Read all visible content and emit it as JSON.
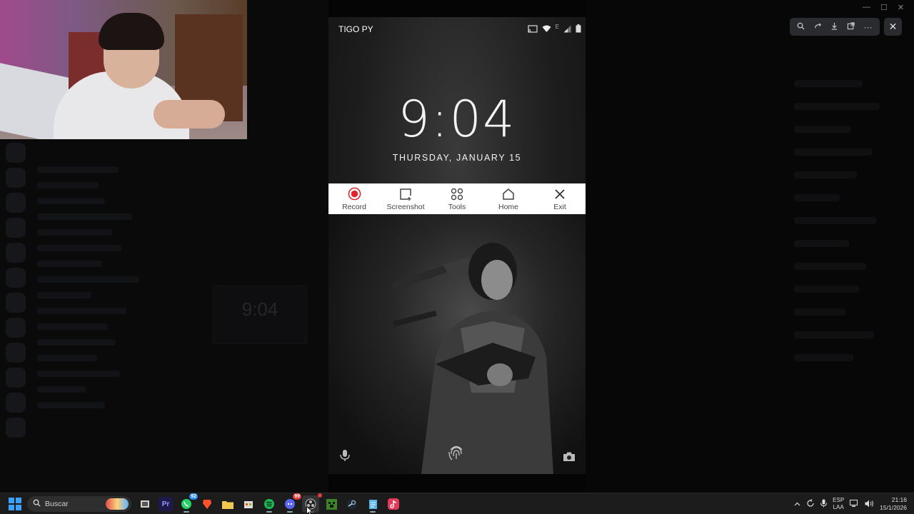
{
  "window": {
    "title": "",
    "viewer_toolbar_icons": [
      "zoom-icon",
      "redo-icon",
      "download-icon",
      "open-external-icon",
      "more-icon"
    ],
    "close_glyph": "✕"
  },
  "phone": {
    "carrier": "TIGO PY",
    "network_letter": "E",
    "time": "9:04",
    "date": "THURSDAY, JANUARY 15",
    "toolbar": {
      "record_label": "Record",
      "screenshot_label": "Screenshot",
      "tools_label": "Tools",
      "home_label": "Home",
      "exit_label": "Exit"
    }
  },
  "background": {
    "mini_time": "9:04"
  },
  "taskbar": {
    "search_label": "Buscar",
    "whatsapp_badge": "92",
    "discord_badge": "99",
    "lang_top": "ESP",
    "lang_bottom": "LAA",
    "clock_time": "21:16",
    "clock_date": "15/1/2026",
    "accent": "#3da2ff"
  },
  "colors": {
    "record_red": "#e3242b",
    "toolbar_bg": "#ffffff"
  }
}
